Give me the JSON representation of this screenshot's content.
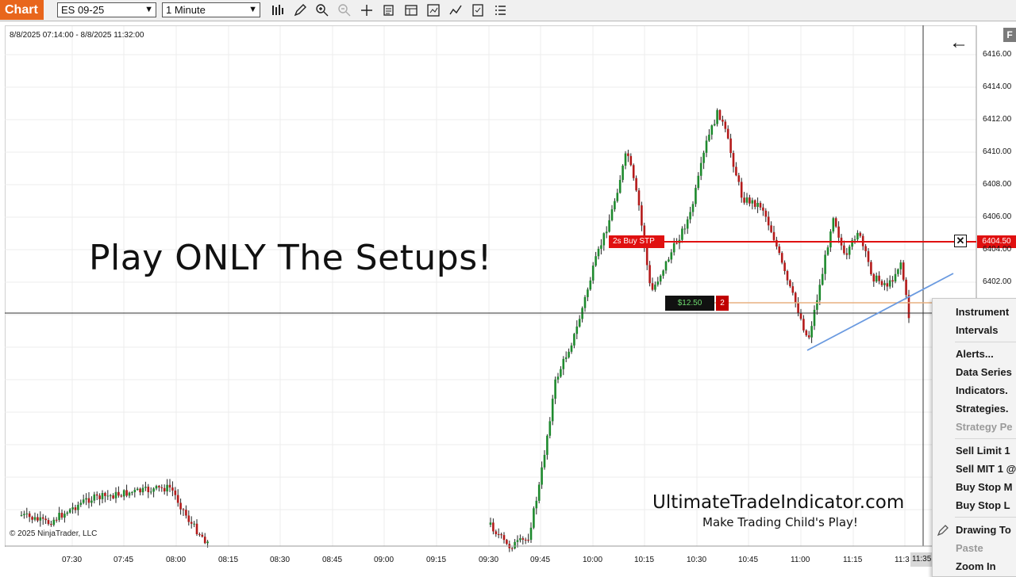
{
  "toolbar": {
    "app_badge": "Chart",
    "instrument_select": "ES 09-25",
    "interval_select": "1 Minute",
    "icons": [
      "bar-type-icon",
      "pencil-icon",
      "zoom-in-icon",
      "zoom-out-icon",
      "crosshair-icon",
      "properties-icon",
      "templates-icon",
      "data-box-icon",
      "indicators-icon",
      "strategies-icon",
      "list-icon"
    ]
  },
  "chart": {
    "date_range": "8/8/2025 07:14:00 - 8/8/2025 11:32:00",
    "copyright": "© 2025 NinjaTrader, LLC",
    "overlay_text": "Play ONLY The Setups!",
    "brand_url": "UltimateTradeIndicator.com",
    "brand_tagline": "Make Trading Child's Play!",
    "order_tag": "2s  Buy STP",
    "order_price": "6404.50",
    "pnl": "$12.50",
    "position_qty": "2",
    "current_time_label": "11:35",
    "f_button": "F",
    "price_axis": [
      "6416.00",
      "6414.00",
      "6412.00",
      "6410.00",
      "6408.00",
      "6406.00",
      "6404.00",
      "6402.00"
    ],
    "time_axis": [
      "07:30",
      "07:45",
      "08:00",
      "08:15",
      "08:30",
      "08:45",
      "09:00",
      "09:15",
      "09:30",
      "09:45",
      "10:00",
      "10:15",
      "10:30",
      "10:45",
      "11:00",
      "11:15",
      "11:3"
    ]
  },
  "context_menu": {
    "items": [
      {
        "label": "Instrument",
        "disabled": false
      },
      {
        "label": "Intervals",
        "disabled": false
      },
      {
        "label": "Alerts...",
        "disabled": false
      },
      {
        "label": "Data Series",
        "disabled": false
      },
      {
        "label": "Indicators.",
        "disabled": false
      },
      {
        "label": "Strategies.",
        "disabled": false
      },
      {
        "label": "Strategy Pe",
        "disabled": true
      },
      {
        "label": "Sell Limit 1",
        "disabled": false
      },
      {
        "label": "Sell MIT 1 @",
        "disabled": false
      },
      {
        "label": "Buy Stop M",
        "disabled": false
      },
      {
        "label": "Buy Stop L",
        "disabled": false
      },
      {
        "label": "Drawing To",
        "disabled": false
      },
      {
        "label": "Paste",
        "disabled": true
      },
      {
        "label": "Zoom In",
        "disabled": false
      }
    ]
  },
  "colors": {
    "up_candle": "#1e8a2e",
    "down_candle": "#b41a1a",
    "order_line": "#e01010",
    "trend_line": "#6a9ae0",
    "entry_line": "#e8b080",
    "badge": "#e8661c"
  }
}
